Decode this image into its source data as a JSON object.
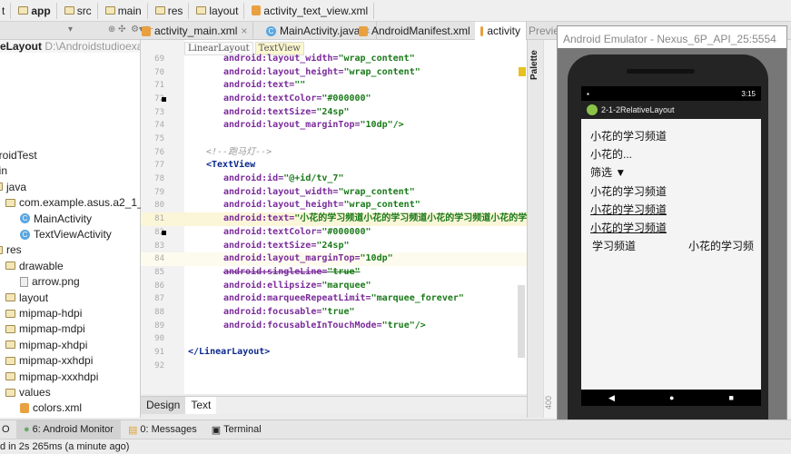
{
  "breadcrumbs": [
    "t",
    "app",
    "src",
    "main",
    "res",
    "layout",
    "activity_text_view.xml"
  ],
  "editor_tabs": [
    {
      "label": "activity_main.xml",
      "close": "×"
    },
    {
      "label": "MainActivity.java",
      "close": "×"
    },
    {
      "label": "AndroidManifest.xml",
      "close": "×"
    },
    {
      "label": "activity",
      "active": true
    }
  ],
  "preview_label": "Preview",
  "project": {
    "header_name": "eLayout",
    "header_path": "D:\\Androidstudioexam\\",
    "items": [
      {
        "label": "droidTest"
      },
      {
        "label": "ain"
      },
      {
        "label": "java"
      },
      {
        "label": "com.example.asus.a2_1_2rela"
      },
      {
        "label": "MainActivity"
      },
      {
        "label": "TextViewActivity"
      },
      {
        "label": "res"
      },
      {
        "label": "drawable"
      },
      {
        "label": "arrow.png"
      },
      {
        "label": "layout"
      },
      {
        "label": "mipmap-hdpi"
      },
      {
        "label": "mipmap-mdpi"
      },
      {
        "label": "mipmap-xhdpi"
      },
      {
        "label": "mipmap-xxhdpi"
      },
      {
        "label": "mipmap-xxxhdpi"
      },
      {
        "label": "values"
      },
      {
        "label": "colors.xml"
      }
    ]
  },
  "editor": {
    "breadcrumb": [
      "LinearLayout",
      "TextView"
    ],
    "lines": [
      {
        "n": "69",
        "a": "android:layout_width=",
        "v": "\"wrap_content\""
      },
      {
        "n": "70",
        "a": "android:layout_height=",
        "v": "\"wrap_content\""
      },
      {
        "n": "71",
        "a": "android:text=",
        "v": "\"\""
      },
      {
        "n": "72",
        "a": "android:textColor=",
        "v": "\"#000000\""
      },
      {
        "n": "73",
        "a": "android:textSize=",
        "v": "\"24sp\""
      },
      {
        "n": "74",
        "a": "android:layout_marginTop=",
        "v": "\"10dp\"/>"
      },
      {
        "n": "75"
      },
      {
        "n": "76",
        "c": "<!--跑马灯-->"
      },
      {
        "n": "77",
        "t": "<TextView"
      },
      {
        "n": "78",
        "a": "android:id=",
        "v": "\"@+id/tv_7\""
      },
      {
        "n": "79",
        "a": "android:layout_width=",
        "v": "\"wrap_content\""
      },
      {
        "n": "80",
        "a": "android:layout_height=",
        "v": "\"wrap_content\""
      },
      {
        "n": "81",
        "a": "android:text=",
        "v": "\"小花的学习频道小花的学习频道小花的学习频道小花的学"
      },
      {
        "n": "82",
        "a": "android:textColor=",
        "v": "\"#000000\""
      },
      {
        "n": "83",
        "a": "android:textSize=",
        "v": "\"24sp\""
      },
      {
        "n": "84",
        "a": "android:layout_marginTop=",
        "v": "\"10dp\""
      },
      {
        "n": "85",
        "a": "android:singleLine=",
        "v": "\"true\""
      },
      {
        "n": "86",
        "a": "android:ellipsize=",
        "v": "\"marquee\""
      },
      {
        "n": "87",
        "a": "android:marqueeRepeatLimit=",
        "v": "\"marquee_forever\""
      },
      {
        "n": "88",
        "a": "android:focusable=",
        "v": "\"true\""
      },
      {
        "n": "89",
        "a": "android:focusableInTouchMode=",
        "v": "\"true\"/>"
      },
      {
        "n": "90"
      },
      {
        "n": "91",
        "t": "</LinearLayout>"
      },
      {
        "n": "92"
      }
    ],
    "bottom_tabs": [
      "Design",
      "Text"
    ]
  },
  "palette_label": "Palette",
  "emulator": {
    "title": "Android Emulator - Nexus_6P_API_25:5554",
    "time": "3:15",
    "app_title": "2-1-2RelativeLayout",
    "texts": [
      "小花的学习频道",
      "小花的...",
      "筛选 ▼",
      "小花的学习频道",
      "小花的学习频道",
      "小花的学习频道"
    ],
    "marquee_left": "学习频道",
    "marquee_right": "小花的学习频",
    "nav": [
      "◀",
      "●",
      "■"
    ]
  },
  "toolwindows": [
    "6: Android Monitor",
    "0: Messages",
    "Terminal"
  ],
  "status_text": "d in 2s 265ms (a minute ago)"
}
